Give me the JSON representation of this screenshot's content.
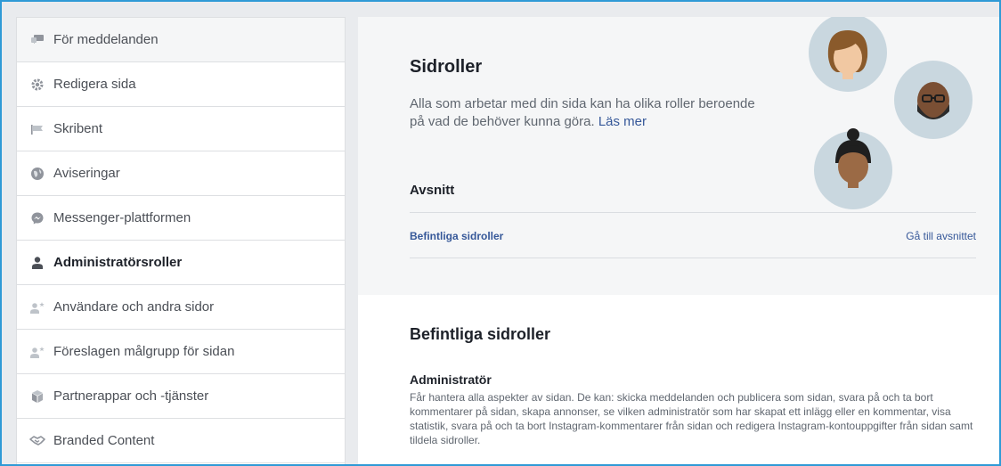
{
  "sidebar": {
    "items": [
      {
        "label": "För meddelanden",
        "icon": "messages-icon"
      },
      {
        "label": "Redigera sida",
        "icon": "gear-icon"
      },
      {
        "label": "Skribent",
        "icon": "flag-icon"
      },
      {
        "label": "Aviseringar",
        "icon": "globe-icon"
      },
      {
        "label": "Messenger-plattformen",
        "icon": "messenger-icon"
      },
      {
        "label": "Administratörsroller",
        "icon": "person-icon"
      },
      {
        "label": "Användare och andra sidor",
        "icon": "person-star-icon"
      },
      {
        "label": "Föreslagen målgrupp för sidan",
        "icon": "person-star-icon"
      },
      {
        "label": "Partnerappar och -tjänster",
        "icon": "cube-icon"
      },
      {
        "label": "Branded Content",
        "icon": "handshake-icon"
      }
    ],
    "active_index": 5
  },
  "main": {
    "title": "Sidroller",
    "intro": "Alla som arbetar med din sida kan ha olika roller beroende på vad de behöver kunna göra.",
    "read_more": "Läs mer",
    "sections_heading": "Avsnitt",
    "section_link": "Befintliga sidroller",
    "goto_label": "Gå till avsnittet",
    "existing_heading": "Befintliga sidroller",
    "role": {
      "title": "Administratör",
      "description": "Får hantera alla aspekter av sidan. De kan: skicka meddelanden och publicera som sidan, svara på och ta bort kommentarer på sidan, skapa annonser, se vilken administratör som har skapat ett inlägg eller en kommentar, visa statistik, svara på och ta bort Instagram-kommentarer från sidan och redigera Instagram-kontouppgifter från sidan samt tildela sidroller."
    }
  },
  "colors": {
    "link": "#365899",
    "frame_border": "#2f9ad6",
    "avatar_bg": "#c9d7df"
  }
}
